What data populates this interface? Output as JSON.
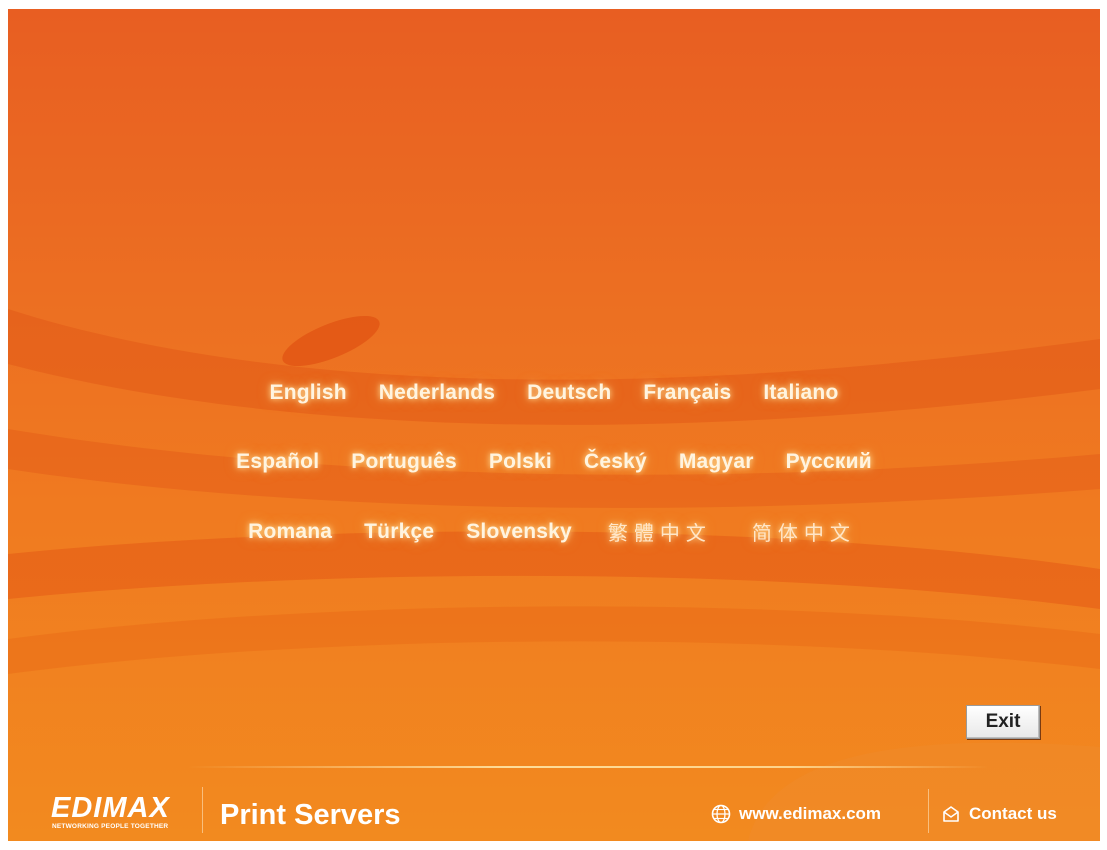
{
  "languages": {
    "row1": [
      "English",
      "Nederlands",
      "Deutsch",
      "Français",
      "Italiano"
    ],
    "row2": [
      "Español",
      "Português",
      "Polski",
      "Český",
      "Magyar",
      "Русский"
    ],
    "row3": [
      "Romana",
      "Türkçe",
      "Slovensky",
      "繁體中文",
      "简体中文"
    ]
  },
  "exit_label": "Exit",
  "footer": {
    "logo_text": "EDIMAX",
    "logo_tagline": "NETWORKING PEOPLE TOGETHER",
    "product_title": "Print Servers",
    "website": "www.edimax.com",
    "contact": "Contact us"
  },
  "icons": {
    "website": "globe-icon",
    "contact": "envelope-icon"
  },
  "colors": {
    "background_top": "#e85e22",
    "background_bottom": "#f28a1f",
    "language_text": "#fff4e0",
    "exit_button": "#ffffff"
  }
}
